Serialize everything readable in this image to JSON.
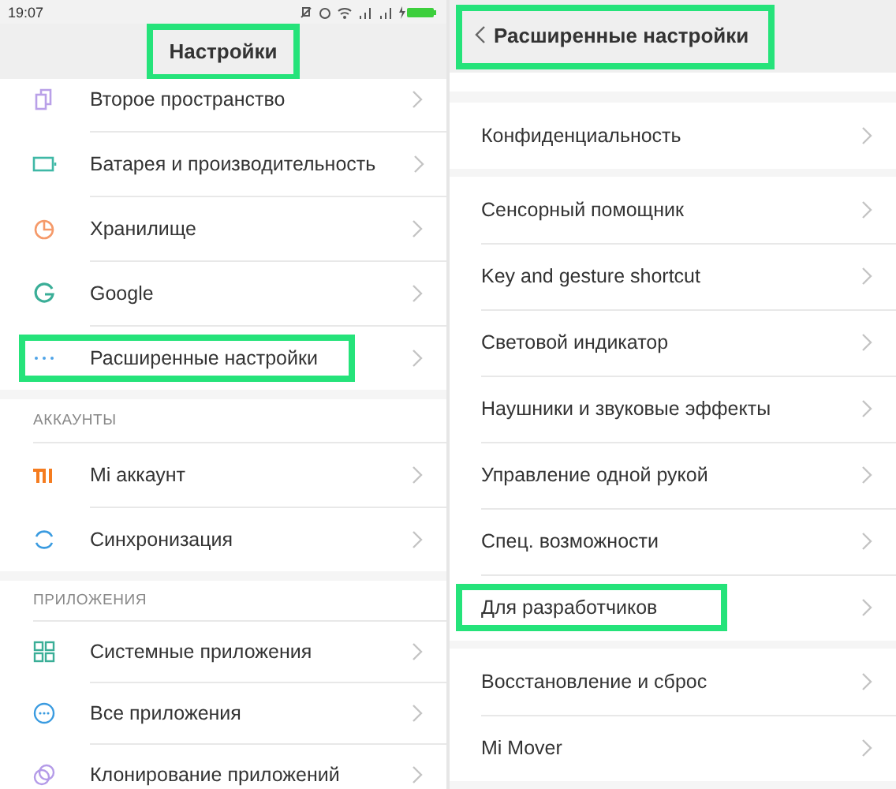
{
  "left_screen": {
    "status_bar": {
      "time": "19:07"
    },
    "title": "Настройки",
    "title_highlighted": true,
    "sections": [
      {
        "items": [
          {
            "label": "Второе пространство",
            "highlighted": false
          },
          {
            "label": "Батарея и производительность",
            "highlighted": false
          },
          {
            "label": "Хранилище",
            "highlighted": false
          },
          {
            "label": "Google",
            "highlighted": false
          },
          {
            "label": "Расширенные настройки",
            "highlighted": true
          }
        ]
      },
      {
        "header": "АККАУНТЫ",
        "items": [
          {
            "label": "Mi аккаунт",
            "highlighted": false
          },
          {
            "label": "Синхронизация",
            "highlighted": false
          }
        ]
      },
      {
        "header": "ПРИЛОЖЕНИЯ",
        "items": [
          {
            "label": "Системные приложения",
            "highlighted": false
          },
          {
            "label": "Все приложения",
            "highlighted": false
          },
          {
            "label": "Клонирование приложений",
            "highlighted": false
          }
        ]
      }
    ]
  },
  "right_screen": {
    "title": "Расширенные настройки",
    "title_highlighted": true,
    "groups": [
      {
        "items": [
          {
            "label": "Конфиденциальность",
            "highlighted": false
          }
        ]
      },
      {
        "items": [
          {
            "label": "Сенсорный помощник",
            "highlighted": false
          },
          {
            "label": "Key and gesture shortcut",
            "highlighted": false
          },
          {
            "label": "Световой индикатор",
            "highlighted": false
          },
          {
            "label": "Наушники и звуковые эффекты",
            "highlighted": false
          },
          {
            "label": "Управление одной рукой",
            "highlighted": false
          },
          {
            "label": "Спец. возможности",
            "highlighted": false
          },
          {
            "label": "Для разработчиков",
            "highlighted": true
          }
        ]
      },
      {
        "items": [
          {
            "label": "Восстановление и сброс",
            "highlighted": false
          },
          {
            "label": "Mi Mover",
            "highlighted": false
          }
        ]
      }
    ]
  }
}
